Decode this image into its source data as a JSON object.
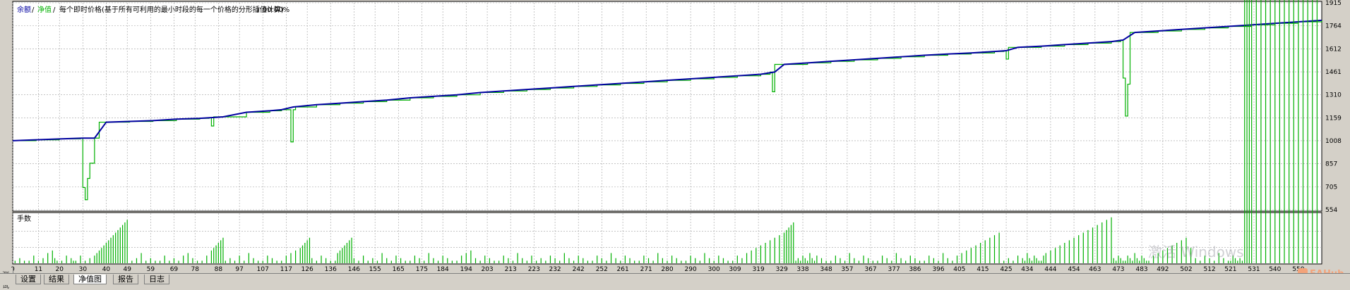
{
  "header": {
    "legend_balance": "余额",
    "sep1": "/",
    "legend_equity": "净值",
    "sep2": "/",
    "model_text": "每个即时价格(基于所有可利用的最小时段的每一个价格的分形插值计算)",
    "sep3": "/",
    "quality": "90.00%"
  },
  "colors": {
    "balance": "#0000a0",
    "equity": "#00b000",
    "lots": "#00b000",
    "grid": "#a0a0a0",
    "plot_bg": "#ffffff",
    "watermark": "#a0a0a8",
    "brand": "#f3a37a"
  },
  "chart_data": [
    {
      "type": "line",
      "title": "",
      "xlabel": "",
      "ylabel": "",
      "y_ticks": [
        554,
        705,
        857,
        1008,
        1159,
        1310,
        1461,
        1612,
        1764,
        1915
      ],
      "ylim": [
        554,
        1915
      ],
      "xlim": [
        0,
        560
      ],
      "x_ticks": [
        0,
        11,
        20,
        30,
        40,
        49,
        59,
        69,
        78,
        88,
        97,
        107,
        117,
        126,
        136,
        146,
        155,
        165,
        175,
        184,
        194,
        203,
        213,
        223,
        232,
        242,
        252,
        261,
        271,
        280,
        290,
        300,
        309,
        319,
        329,
        338,
        348,
        357,
        367,
        377,
        386,
        396,
        405,
        415,
        425,
        434,
        444,
        454,
        463,
        473,
        483,
        492,
        502,
        512,
        521,
        531,
        540,
        550
      ],
      "grid": true,
      "series": [
        {
          "name": "余额",
          "x": [
            0,
            10,
            20,
            30,
            35,
            40,
            50,
            60,
            70,
            80,
            85,
            90,
            100,
            110,
            115,
            120,
            130,
            140,
            150,
            160,
            170,
            180,
            190,
            200,
            210,
            220,
            230,
            240,
            250,
            260,
            270,
            280,
            290,
            300,
            310,
            320,
            326,
            330,
            340,
            350,
            360,
            370,
            380,
            390,
            400,
            410,
            420,
            425,
            430,
            440,
            450,
            460,
            470,
            475,
            480,
            490,
            500,
            510,
            520,
            530,
            540,
            550,
            560
          ],
          "values": [
            1008,
            1014,
            1020,
            1025,
            1025,
            1130,
            1135,
            1140,
            1150,
            1155,
            1160,
            1165,
            1195,
            1205,
            1212,
            1230,
            1245,
            1255,
            1265,
            1275,
            1290,
            1300,
            1310,
            1325,
            1335,
            1345,
            1355,
            1365,
            1375,
            1385,
            1395,
            1405,
            1415,
            1425,
            1435,
            1445,
            1460,
            1510,
            1520,
            1530,
            1540,
            1550,
            1560,
            1570,
            1578,
            1585,
            1595,
            1600,
            1622,
            1630,
            1640,
            1650,
            1660,
            1670,
            1720,
            1730,
            1740,
            1750,
            1760,
            1770,
            1780,
            1790,
            1800
          ]
        },
        {
          "name": "净值",
          "x": [
            0,
            10,
            20,
            29,
            30,
            31,
            32,
            33,
            34,
            35,
            36,
            37,
            40,
            50,
            60,
            70,
            80,
            84,
            85,
            86,
            90,
            100,
            110,
            115,
            118,
            119,
            120,
            121,
            125,
            130,
            140,
            150,
            160,
            170,
            180,
            190,
            200,
            210,
            220,
            230,
            240,
            250,
            260,
            270,
            280,
            290,
            300,
            310,
            320,
            324,
            325,
            326,
            330,
            340,
            350,
            360,
            370,
            380,
            390,
            400,
            410,
            420,
            424,
            425,
            426,
            430,
            440,
            450,
            460,
            470,
            474,
            475,
            476,
            477,
            478,
            480,
            490,
            500,
            510,
            520,
            530,
            540,
            550,
            560
          ],
          "values": [
            1008,
            1014,
            1020,
            1025,
            700,
            620,
            760,
            860,
            860,
            1025,
            1025,
            1130,
            1130,
            1135,
            1140,
            1150,
            1155,
            1160,
            1105,
            1165,
            1165,
            1195,
            1205,
            1212,
            1212,
            1000,
            1212,
            1230,
            1230,
            1245,
            1255,
            1265,
            1275,
            1290,
            1300,
            1310,
            1325,
            1335,
            1345,
            1355,
            1365,
            1375,
            1385,
            1395,
            1405,
            1415,
            1425,
            1435,
            1445,
            1460,
            1330,
            1510,
            1510,
            1520,
            1530,
            1540,
            1550,
            1560,
            1570,
            1578,
            1585,
            1595,
            1600,
            1545,
            1622,
            1622,
            1630,
            1640,
            1650,
            1660,
            1670,
            1420,
            1170,
            1380,
            1720,
            1720,
            1730,
            1740,
            1750,
            1760,
            1770,
            1780,
            1790,
            1800
          ]
        }
      ]
    },
    {
      "type": "bar",
      "title": "手数",
      "xlabel": "",
      "ylabel": "",
      "grid": true,
      "x": [
        1,
        3,
        5,
        7,
        9,
        11,
        13,
        15,
        17,
        18,
        19,
        21,
        23,
        25,
        26,
        27,
        29,
        31,
        33,
        35,
        36,
        37,
        38,
        39,
        40,
        41,
        42,
        43,
        44,
        45,
        46,
        47,
        48,
        49,
        51,
        53,
        55,
        57,
        59,
        61,
        63,
        65,
        67,
        69,
        71,
        73,
        75,
        77,
        79,
        81,
        83,
        85,
        86,
        87,
        88,
        89,
        90,
        91,
        93,
        95,
        97,
        99,
        101,
        103,
        105,
        107,
        109,
        111,
        113,
        115,
        117,
        119,
        121,
        123,
        124,
        125,
        126,
        127,
        128,
        130,
        132,
        134,
        136,
        138,
        139,
        140,
        141,
        142,
        143,
        144,
        145,
        146,
        148,
        150,
        152,
        154,
        156,
        158,
        160,
        162,
        164,
        166,
        168,
        170,
        172,
        174,
        176,
        178,
        180,
        182,
        184,
        186,
        188,
        190,
        192,
        194,
        196,
        198,
        200,
        202,
        204,
        206,
        208,
        210,
        212,
        214,
        216,
        218,
        220,
        222,
        224,
        226,
        228,
        230,
        232,
        234,
        236,
        238,
        240,
        242,
        244,
        246,
        248,
        250,
        252,
        254,
        256,
        258,
        260,
        262,
        264,
        266,
        268,
        270,
        272,
        274,
        276,
        278,
        280,
        282,
        284,
        286,
        288,
        290,
        292,
        294,
        296,
        298,
        300,
        302,
        304,
        306,
        308,
        310,
        312,
        314,
        316,
        318,
        320,
        322,
        324,
        326,
        328,
        330,
        331,
        332,
        333,
        334,
        335,
        336,
        337,
        338,
        339,
        340,
        341,
        342,
        343,
        344,
        346,
        348,
        350,
        352,
        354,
        356,
        358,
        360,
        362,
        364,
        366,
        368,
        370,
        372,
        374,
        376,
        378,
        380,
        382,
        384,
        386,
        388,
        390,
        392,
        394,
        396,
        398,
        400,
        402,
        404,
        406,
        408,
        410,
        412,
        414,
        416,
        418,
        420,
        422,
        424,
        426,
        428,
        430,
        432,
        433,
        434,
        435,
        436,
        437,
        438,
        439,
        440,
        441,
        442,
        444,
        446,
        448,
        450,
        452,
        454,
        456,
        458,
        460,
        462,
        464,
        466,
        468,
        470,
        471,
        472,
        473,
        474,
        475,
        476,
        477,
        478,
        479,
        480,
        481,
        482,
        483,
        484,
        485,
        486,
        488,
        490,
        492,
        494,
        496,
        498,
        500,
        502,
        504,
        506,
        508,
        510,
        512,
        514,
        516,
        518,
        520,
        521,
        522,
        523,
        524,
        525,
        526,
        527,
        528,
        529,
        530,
        532,
        534,
        536,
        538,
        540,
        542,
        544,
        546,
        548,
        550,
        552,
        554,
        556,
        558
      ],
      "values": [
        0.8,
        1.6,
        0.8,
        0.8,
        2.4,
        0.8,
        1.6,
        3.2,
        4.0,
        1.6,
        0.8,
        0.8,
        2.4,
        1.6,
        0.8,
        0.8,
        2.4,
        0.8,
        1.6,
        2.4,
        3.2,
        4.0,
        4.8,
        5.6,
        6.4,
        7.2,
        8.0,
        8.8,
        9.6,
        10.4,
        11.2,
        12.0,
        12.8,
        13.6,
        0.8,
        1.6,
        3.2,
        0.8,
        1.6,
        0.8,
        0.8,
        2.4,
        0.8,
        1.6,
        0.8,
        2.4,
        3.2,
        1.6,
        0.8,
        0.8,
        2.4,
        4.0,
        4.8,
        5.6,
        6.4,
        7.2,
        8.0,
        0.8,
        1.6,
        0.8,
        2.4,
        0.8,
        3.2,
        1.6,
        0.8,
        0.8,
        2.4,
        1.6,
        0.8,
        0.8,
        2.4,
        3.2,
        4.0,
        4.8,
        5.6,
        6.4,
        7.2,
        8.0,
        1.6,
        0.8,
        2.4,
        1.6,
        0.8,
        0.8,
        3.2,
        4.0,
        4.8,
        5.6,
        6.4,
        7.2,
        8.0,
        1.6,
        0.8,
        2.4,
        0.8,
        1.6,
        0.8,
        3.2,
        1.6,
        0.8,
        2.4,
        1.6,
        0.8,
        0.8,
        2.4,
        1.6,
        0.8,
        3.2,
        1.6,
        0.8,
        2.4,
        1.6,
        0.8,
        0.8,
        2.4,
        3.2,
        4.0,
        1.6,
        0.8,
        2.4,
        1.6,
        0.8,
        0.8,
        2.4,
        1.6,
        0.8,
        3.2,
        1.6,
        0.8,
        2.4,
        0.8,
        1.6,
        0.8,
        2.4,
        1.6,
        0.8,
        3.2,
        1.6,
        0.8,
        2.4,
        1.6,
        0.8,
        0.8,
        2.4,
        1.6,
        0.8,
        3.2,
        1.6,
        0.8,
        2.4,
        1.6,
        0.8,
        0.8,
        2.4,
        1.6,
        0.8,
        3.2,
        1.6,
        0.8,
        2.4,
        1.6,
        0.8,
        0.8,
        2.4,
        1.6,
        0.8,
        3.2,
        1.6,
        0.8,
        2.4,
        1.6,
        0.8,
        0.8,
        2.4,
        1.6,
        3.2,
        4.0,
        4.8,
        5.6,
        6.4,
        7.2,
        8.0,
        8.8,
        9.6,
        10.4,
        11.2,
        12.0,
        12.8,
        0.8,
        1.6,
        0.8,
        2.4,
        1.6,
        0.8,
        3.2,
        1.6,
        0.8,
        2.4,
        1.6,
        0.8,
        0.8,
        2.4,
        1.6,
        0.8,
        3.2,
        1.6,
        0.8,
        2.4,
        1.6,
        0.8,
        0.8,
        2.4,
        1.6,
        0.8,
        3.2,
        1.6,
        0.8,
        2.4,
        1.6,
        0.8,
        0.8,
        2.4,
        1.6,
        0.8,
        3.2,
        1.6,
        0.8,
        2.4,
        3.2,
        4.0,
        4.8,
        5.6,
        6.4,
        7.2,
        8.0,
        8.8,
        9.6,
        0.8,
        1.6,
        0.8,
        2.4,
        1.6,
        0.8,
        3.2,
        1.6,
        0.8,
        2.4,
        1.6,
        0.8,
        0.8,
        2.4,
        3.2,
        4.0,
        4.8,
        5.6,
        6.4,
        7.2,
        8.0,
        8.8,
        9.6,
        10.4,
        11.2,
        12.0,
        12.8,
        13.6,
        14.4,
        1.6,
        0.8,
        2.4,
        1.6,
        0.8,
        0.8,
        2.4,
        1.6,
        0.8,
        3.2,
        1.6,
        0.8,
        2.4,
        1.6,
        0.8,
        0.8,
        2.4,
        3.2,
        4.0,
        4.8,
        5.6,
        6.4,
        7.2,
        8.0,
        4.8,
        1.6,
        0.8,
        2.4,
        1.6,
        0.8,
        3.2,
        1.6,
        0.8,
        0.8,
        2.4,
        1.6,
        0.8,
        1.6,
        0.8
      ]
    }
  ],
  "tabs": [
    {
      "label": "设置",
      "active": false
    },
    {
      "label": "结果",
      "active": false
    },
    {
      "label": "净值图",
      "active": true
    },
    {
      "label": "报告",
      "active": false
    },
    {
      "label": "日志",
      "active": false
    }
  ],
  "side_caption": "测试",
  "watermark": "激活 Windows",
  "brand": "EAHub"
}
